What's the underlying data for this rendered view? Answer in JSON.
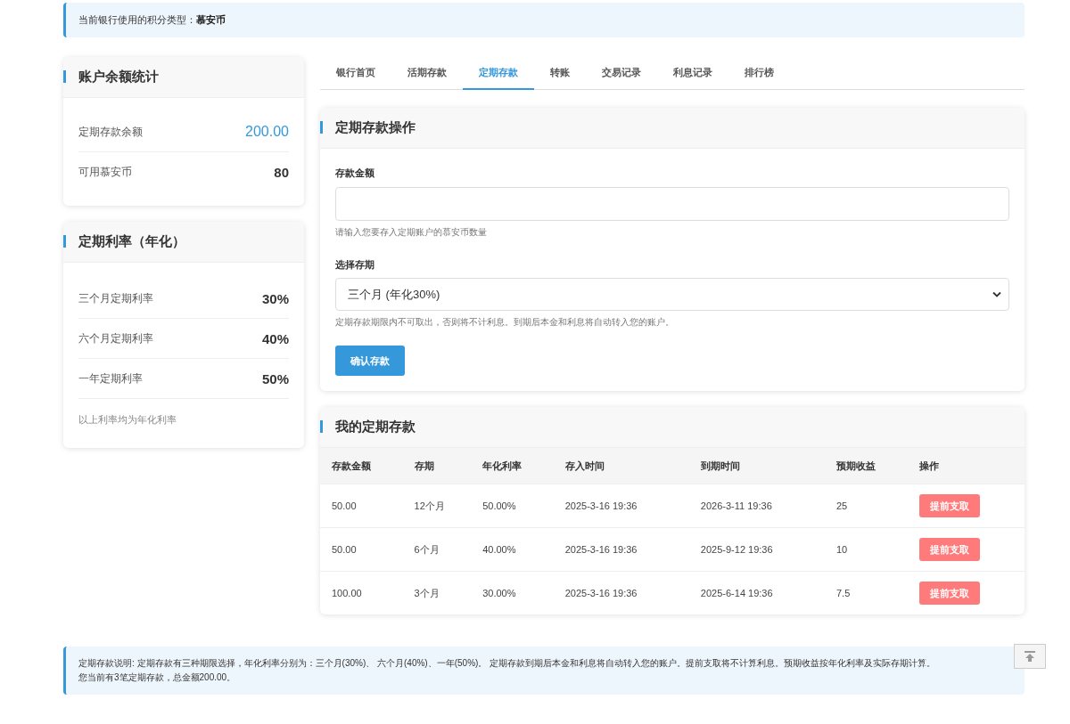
{
  "notice": {
    "label": "当前银行使用的积分类型：",
    "value": "慕安币"
  },
  "balance_card": {
    "title": "账户余额统计",
    "rows": [
      {
        "label": "定期存款余额",
        "value": "200.00",
        "highlight": true
      },
      {
        "label": "可用慕安币",
        "value": "80",
        "highlight": false
      }
    ]
  },
  "rates_card": {
    "title": "定期利率（年化）",
    "rows": [
      {
        "label": "三个月定期利率",
        "value": "30%"
      },
      {
        "label": "六个月定期利率",
        "value": "40%"
      },
      {
        "label": "一年定期利率",
        "value": "50%"
      }
    ],
    "note": "以上利率均为年化利率"
  },
  "tabs": [
    {
      "label": "银行首页",
      "selected": false
    },
    {
      "label": "活期存款",
      "selected": false
    },
    {
      "label": "定期存款",
      "selected": true
    },
    {
      "label": "转账",
      "selected": false
    },
    {
      "label": "交易记录",
      "selected": false
    },
    {
      "label": "利息记录",
      "selected": false
    },
    {
      "label": "排行榜",
      "selected": false
    }
  ],
  "deposit_form": {
    "title": "定期存款操作",
    "amount_label": "存款金额",
    "amount_hint": "请输入您要存入定期账户的慕安币数量",
    "term_label": "选择存期",
    "term_value": "三个月 (年化30%)",
    "term_hint": "定期存款期限内不可取出，否则将不计利息。到期后本金和利息将自动转入您的账户。",
    "submit": "确认存款"
  },
  "deposits": {
    "title": "我的定期存款",
    "columns": [
      "存款金额",
      "存期",
      "年化利率",
      "存入时间",
      "到期时间",
      "预期收益",
      "操作"
    ],
    "rows": [
      {
        "amount": "50.00",
        "term": "12个月",
        "rate": "50.00%",
        "start": "2025-3-16 19:36",
        "end": "2026-3-11 19:36",
        "yield": "25",
        "action": "提前支取"
      },
      {
        "amount": "50.00",
        "term": "6个月",
        "rate": "40.00%",
        "start": "2025-3-16 19:36",
        "end": "2025-9-12 19:36",
        "yield": "10",
        "action": "提前支取"
      },
      {
        "amount": "100.00",
        "term": "3个月",
        "rate": "30.00%",
        "start": "2025-3-16 19:36",
        "end": "2025-6-14 19:36",
        "yield": "7.5",
        "action": "提前支取"
      }
    ]
  },
  "footer_note": {
    "lines": [
      "定期存款说明: 定期存款有三种期限选择，年化利率分别为：三个月(30%)、 六个月(40%)、一年(50%)。 定期存款到期后本金和利息将自动转入您的账户。提前支取将不计算利息。预期收益按年化利率及实际存期计算。",
      "您当前有3笔定期存款，总金额200.00。"
    ]
  }
}
